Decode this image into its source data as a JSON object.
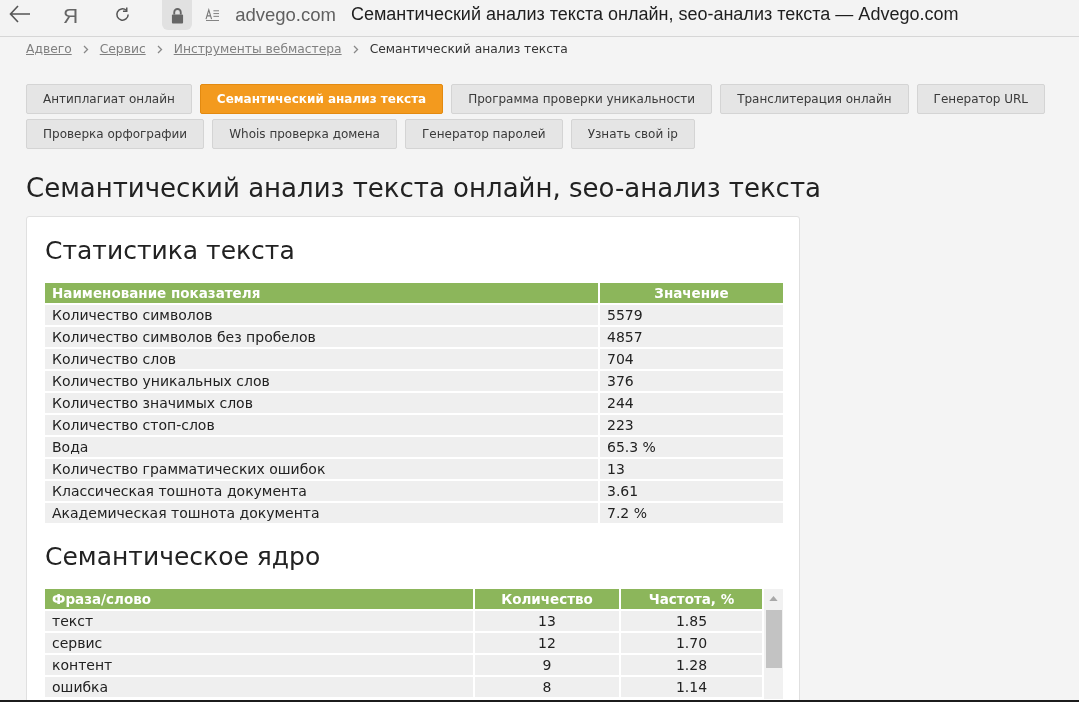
{
  "browser": {
    "logo": "Я",
    "address": "advego.com",
    "page_title": "Семантический анализ текста онлайн, seo-анализ текста — Advego.com"
  },
  "breadcrumbs": [
    {
      "label": "Адвего",
      "link": true
    },
    {
      "label": "Сервис",
      "link": true
    },
    {
      "label": "Инструменты вебмастера",
      "link": true
    },
    {
      "label": "Семантический анализ текста",
      "link": false
    }
  ],
  "tabs": [
    {
      "label": "Антиплагиат онлайн",
      "selected": false
    },
    {
      "label": "Семантический анализ текста",
      "selected": true
    },
    {
      "label": "Программа проверки уникальности",
      "selected": false
    },
    {
      "label": "Транслитерация онлайн",
      "selected": false
    },
    {
      "label": "Генератор URL",
      "selected": false
    },
    {
      "label": "Проверка орфографии",
      "selected": false
    },
    {
      "label": "Whois проверка домена",
      "selected": false
    },
    {
      "label": "Генератор паролей",
      "selected": false
    },
    {
      "label": "Узнать свой ip",
      "selected": false
    }
  ],
  "heading": "Семантический анализ текста онлайн, seo-анализ текста",
  "stats": {
    "title": "Статистика текста",
    "columns": [
      "Наименование показателя",
      "Значение"
    ],
    "rows": [
      [
        "Количество символов",
        "5579"
      ],
      [
        "Количество символов без пробелов",
        "4857"
      ],
      [
        "Количество слов",
        "704"
      ],
      [
        "Количество уникальных слов",
        "376"
      ],
      [
        "Количество значимых слов",
        "244"
      ],
      [
        "Количество стоп-слов",
        "223"
      ],
      [
        "Вода",
        "65.3 %"
      ],
      [
        "Количество грамматических ошибок",
        "13"
      ],
      [
        "Классическая тошнота документа",
        "3.61"
      ],
      [
        "Академическая тошнота документа",
        "7.2 %"
      ]
    ]
  },
  "semantic_core": {
    "title": "Семантическое ядро",
    "columns": [
      "Фраза/слово",
      "Количество",
      "Частота, %"
    ],
    "rows": [
      [
        "текст",
        "13",
        "1.85"
      ],
      [
        "сервис",
        "12",
        "1.70"
      ],
      [
        "контент",
        "9",
        "1.28"
      ],
      [
        "ошибка",
        "8",
        "1.14"
      ]
    ]
  }
}
